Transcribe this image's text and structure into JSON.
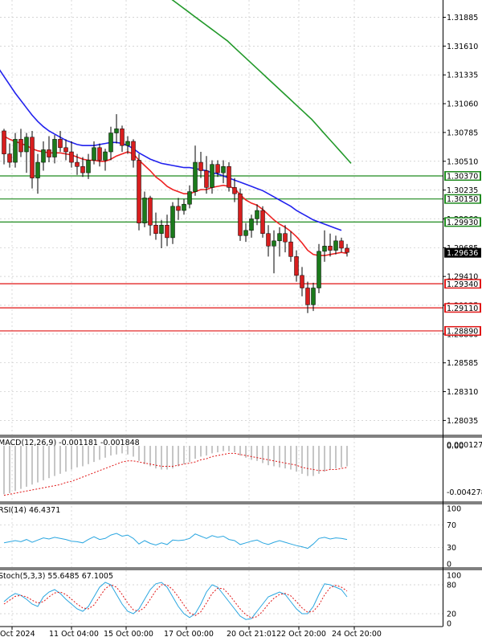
{
  "chart_data": {
    "type": "candlestick",
    "price_axis": {
      "range": [
        1.279,
        1.3205
      ],
      "ticks": [
        "1.31885",
        "1.31610",
        "1.31335",
        "1.31060",
        "1.30785",
        "1.30510",
        "1.30235",
        "1.29960",
        "1.29685",
        "1.29410",
        "1.29135",
        "1.28860",
        "1.28585",
        "1.28310",
        "1.28035"
      ]
    },
    "time_axis": {
      "labels": [
        "Oct 2024",
        "11 Oct 04:00",
        "15 Oct 00:00",
        "17 Oct 00:00",
        "20 Oct 21:01",
        "22 Oct 20:00",
        "24 Oct 20:00"
      ]
    },
    "current_price": "1.29636",
    "resistance_levels": [
      "1.30370",
      "1.30150",
      "1.29930"
    ],
    "support_levels": [
      "1.29340",
      "1.29110",
      "1.28890"
    ],
    "colors": {
      "bull": "#1b7a1b",
      "bear": "#d81e1e",
      "ma_fast": "#ee2222",
      "ma_mid": "#2222ee",
      "ma_slow": "#22992a",
      "resistance": "#1e8a1e",
      "support": "#e01515",
      "grid": "#c8c8c8",
      "signal": "#e01515",
      "stoch_main": "#2aa6e0"
    },
    "candles": [
      [
        1.308,
        1.3082,
        1.3048,
        1.3058
      ],
      [
        1.3058,
        1.3068,
        1.3045,
        1.305
      ],
      [
        1.305,
        1.3078,
        1.3045,
        1.3072
      ],
      [
        1.3072,
        1.3082,
        1.3055,
        1.306
      ],
      [
        1.306,
        1.3078,
        1.304,
        1.3074
      ],
      [
        1.3074,
        1.308,
        1.3025,
        1.3035
      ],
      [
        1.3035,
        1.3058,
        1.302,
        1.305
      ],
      [
        1.305,
        1.307,
        1.3042,
        1.3062
      ],
      [
        1.3062,
        1.3075,
        1.305,
        1.3055
      ],
      [
        1.3055,
        1.3076,
        1.3049,
        1.3072
      ],
      [
        1.3072,
        1.308,
        1.306,
        1.3064
      ],
      [
        1.3064,
        1.3072,
        1.3052,
        1.306
      ],
      [
        1.306,
        1.307,
        1.3045,
        1.305
      ],
      [
        1.305,
        1.3058,
        1.3038,
        1.3046
      ],
      [
        1.3046,
        1.3055,
        1.3036,
        1.304
      ],
      [
        1.304,
        1.3058,
        1.3034,
        1.3052
      ],
      [
        1.3052,
        1.307,
        1.3048,
        1.3064
      ],
      [
        1.3064,
        1.3068,
        1.3046,
        1.3052
      ],
      [
        1.3052,
        1.3063,
        1.3042,
        1.306
      ],
      [
        1.306,
        1.3084,
        1.3052,
        1.3078
      ],
      [
        1.3078,
        1.3096,
        1.3068,
        1.3082
      ],
      [
        1.3082,
        1.3085,
        1.306,
        1.3066
      ],
      [
        1.3066,
        1.3075,
        1.3058,
        1.307
      ],
      [
        1.307,
        1.3072,
        1.3045,
        1.3052
      ],
      [
        1.3052,
        1.3058,
        1.2985,
        1.2992
      ],
      [
        1.2992,
        1.3022,
        1.2988,
        1.3016
      ],
      [
        1.3016,
        1.3018,
        1.298,
        1.299
      ],
      [
        1.299,
        1.3002,
        1.2976,
        1.2982
      ],
      [
        1.2982,
        1.2995,
        1.2968,
        1.299
      ],
      [
        1.299,
        1.3,
        1.297,
        1.2978
      ],
      [
        1.2978,
        1.3012,
        1.2972,
        1.3008
      ],
      [
        1.3008,
        1.3016,
        1.2995,
        1.3004
      ],
      [
        1.3004,
        1.3015,
        1.3,
        1.301
      ],
      [
        1.301,
        1.3028,
        1.3006,
        1.3022
      ],
      [
        1.3022,
        1.3066,
        1.3018,
        1.305
      ],
      [
        1.305,
        1.306,
        1.3035,
        1.3042
      ],
      [
        1.3042,
        1.3056,
        1.302,
        1.3026
      ],
      [
        1.3026,
        1.3052,
        1.302,
        1.3048
      ],
      [
        1.3048,
        1.3052,
        1.3036,
        1.304
      ],
      [
        1.304,
        1.3052,
        1.303,
        1.3046
      ],
      [
        1.3046,
        1.305,
        1.3022,
        1.3026
      ],
      [
        1.3026,
        1.3035,
        1.3012,
        1.302
      ],
      [
        1.302,
        1.3025,
        1.2975,
        1.298
      ],
      [
        1.298,
        1.2992,
        1.2974,
        1.2985
      ],
      [
        1.2985,
        1.3,
        1.2978,
        1.2996
      ],
      [
        1.2996,
        1.301,
        1.299,
        1.3004
      ],
      [
        1.3004,
        1.3008,
        1.2978,
        1.2982
      ],
      [
        1.2982,
        1.299,
        1.296,
        1.297
      ],
      [
        1.297,
        1.2985,
        1.2944,
        1.2975
      ],
      [
        1.2975,
        1.2988,
        1.296,
        1.2982
      ],
      [
        1.2982,
        1.299,
        1.2964,
        1.2974
      ],
      [
        1.2974,
        1.2984,
        1.2955,
        1.296
      ],
      [
        1.296,
        1.2966,
        1.2936,
        1.2942
      ],
      [
        1.2942,
        1.295,
        1.2922,
        1.293
      ],
      [
        1.293,
        1.2936,
        1.2906,
        1.2914
      ],
      [
        1.2914,
        1.2935,
        1.2908,
        1.293
      ],
      [
        1.293,
        1.2972,
        1.2925,
        1.2965
      ],
      [
        1.2965,
        1.2985,
        1.2955,
        1.297
      ],
      [
        1.297,
        1.2982,
        1.296,
        1.2966
      ],
      [
        1.2966,
        1.298,
        1.2962,
        1.2975
      ],
      [
        1.2975,
        1.2978,
        1.2964,
        1.2968
      ],
      [
        1.2968,
        1.2972,
        1.296,
        1.2964
      ]
    ],
    "ma_fast": [
      1.3075,
      1.3072,
      1.307,
      1.3068,
      1.3066,
      1.3063,
      1.3061,
      1.306,
      1.3059,
      1.3059,
      1.3059,
      1.3058,
      1.3057,
      1.3055,
      1.3053,
      1.3052,
      1.3052,
      1.3051,
      1.3051,
      1.3053,
      1.3056,
      1.3058,
      1.306,
      1.3058,
      1.3052,
      1.3047,
      1.3042,
      1.3036,
      1.3032,
      1.3027,
      1.3024,
      1.3022,
      1.302,
      1.302,
      1.3022,
      1.3024,
      1.3024,
      1.3026,
      1.3027,
      1.3028,
      1.3027,
      1.3025,
      1.3019,
      1.3014,
      1.3011,
      1.3009,
      1.3005,
      1.3,
      1.2995,
      1.2991,
      1.2988,
      1.2984,
      1.2979,
      1.2973,
      1.2966,
      1.2962,
      1.2961,
      1.2961,
      1.2962,
      1.2963,
      1.2964,
      1.2963
    ],
    "ma_mid": [
      1.314,
      1.3132,
      1.3124,
      1.3116,
      1.3109,
      1.3102,
      1.3095,
      1.3089,
      1.3084,
      1.308,
      1.3077,
      1.3074,
      1.3071,
      1.3069,
      1.3067,
      1.3066,
      1.3066,
      1.3066,
      1.3067,
      1.3068,
      1.3069,
      1.3069,
      1.3068,
      1.3066,
      1.3063,
      1.3059,
      1.3056,
      1.3053,
      1.3051,
      1.3049,
      1.3048,
      1.3047,
      1.3046,
      1.3045,
      1.3045,
      1.3044,
      1.3043,
      1.3042,
      1.304,
      1.3039,
      1.3037,
      1.3035,
      1.3033,
      1.3031,
      1.3029,
      1.3027,
      1.3025,
      1.3023,
      1.302,
      1.3017,
      1.3014,
      1.3011,
      1.3008,
      1.3004,
      1.3001,
      1.2998,
      1.2995,
      1.2993,
      1.2991,
      1.2989,
      1.2987,
      1.2985
    ],
    "ma_slow": [
      1.325,
      1.3245,
      1.324,
      1.3235,
      1.323,
      1.3225,
      1.322,
      1.3215,
      1.321,
      1.3206,
      1.3202,
      1.3198,
      1.3194,
      1.319,
      1.3186,
      1.3182,
      1.3178,
      1.3174,
      1.317,
      1.3166,
      1.3161,
      1.3156,
      1.3151,
      1.3146,
      1.3141,
      1.3136,
      1.3131,
      1.3126,
      1.3121,
      1.3116,
      1.3111,
      1.3106,
      1.3101,
      1.3096,
      1.3091,
      1.3085,
      1.3079,
      1.3073,
      1.3067,
      1.3061,
      1.3055,
      1.3049
    ],
    "ma_slow_start_index": 20,
    "macd": {
      "label": "MACD(12,26,9) -0.001181 -0.001848",
      "ticks": [
        "0.000127",
        "0.00",
        "-0.004278"
      ],
      "range": [
        -0.005,
        0.0006
      ],
      "hist": [
        -0.0045,
        -0.0044,
        -0.0042,
        -0.004,
        -0.0038,
        -0.0036,
        -0.0034,
        -0.0032,
        -0.003,
        -0.0028,
        -0.0026,
        -0.0024,
        -0.0022,
        -0.002,
        -0.0019,
        -0.0017,
        -0.0015,
        -0.0013,
        -0.0011,
        -0.0009,
        -0.0008,
        -0.0007,
        -0.0008,
        -0.001,
        -0.0014,
        -0.0017,
        -0.0019,
        -0.0021,
        -0.0022,
        -0.0022,
        -0.0021,
        -0.0019,
        -0.0017,
        -0.0015,
        -0.0012,
        -0.001,
        -0.0009,
        -0.0007,
        -0.0006,
        -0.0005,
        -0.0005,
        -0.0006,
        -0.0009,
        -0.0011,
        -0.0013,
        -0.0014,
        -0.0016,
        -0.0018,
        -0.0019,
        -0.002,
        -0.0021,
        -0.0022,
        -0.0024,
        -0.0026,
        -0.0028,
        -0.0028,
        -0.0026,
        -0.0024,
        -0.0022,
        -0.0021,
        -0.002,
        -0.0019
      ],
      "signal": [
        -0.0046,
        -0.0045,
        -0.0044,
        -0.0043,
        -0.0042,
        -0.0041,
        -0.004,
        -0.0039,
        -0.0038,
        -0.0037,
        -0.0036,
        -0.0034,
        -0.0033,
        -0.0031,
        -0.0029,
        -0.0027,
        -0.0025,
        -0.0023,
        -0.0021,
        -0.0019,
        -0.0017,
        -0.0015,
        -0.0014,
        -0.0014,
        -0.0015,
        -0.0016,
        -0.0017,
        -0.0018,
        -0.0019,
        -0.0019,
        -0.0019,
        -0.0018,
        -0.0017,
        -0.0016,
        -0.0015,
        -0.0013,
        -0.0012,
        -0.001,
        -0.0009,
        -0.0008,
        -0.0007,
        -0.0007,
        -0.0008,
        -0.0009,
        -0.001,
        -0.0011,
        -0.0012,
        -0.0013,
        -0.0014,
        -0.0015,
        -0.0016,
        -0.0017,
        -0.0018,
        -0.002,
        -0.0021,
        -0.0022,
        -0.0023,
        -0.0023,
        -0.0022,
        -0.0022,
        -0.0021,
        -0.002
      ]
    },
    "rsi": {
      "label": "RSI(14) 46.4371",
      "ticks": [
        "100",
        "70",
        "30",
        "0"
      ],
      "range": [
        0,
        100
      ],
      "values": [
        38,
        40,
        42,
        40,
        44,
        39,
        43,
        47,
        45,
        48,
        46,
        44,
        41,
        40,
        38,
        44,
        49,
        44,
        46,
        52,
        55,
        50,
        52,
        46,
        36,
        42,
        37,
        34,
        38,
        35,
        43,
        42,
        43,
        46,
        54,
        50,
        46,
        51,
        48,
        50,
        44,
        42,
        35,
        38,
        41,
        43,
        38,
        35,
        39,
        42,
        39,
        36,
        33,
        31,
        28,
        36,
        46,
        48,
        45,
        47,
        46,
        44
      ]
    },
    "stoch": {
      "label": "Stoch(5,3,3) 55.6485 67.1005",
      "ticks": [
        "100",
        "80",
        "20",
        "0"
      ],
      "range": [
        0,
        100
      ],
      "main": [
        45,
        55,
        62,
        58,
        50,
        40,
        35,
        55,
        65,
        70,
        62,
        50,
        40,
        30,
        25,
        35,
        55,
        75,
        85,
        80,
        60,
        40,
        25,
        20,
        30,
        50,
        70,
        82,
        85,
        75,
        55,
        35,
        20,
        12,
        20,
        40,
        65,
        80,
        75,
        60,
        45,
        30,
        15,
        8,
        10,
        25,
        40,
        55,
        60,
        65,
        60,
        45,
        30,
        20,
        20,
        35,
        60,
        82,
        80,
        75,
        70,
        55
      ],
      "signal": [
        40,
        48,
        56,
        58,
        55,
        48,
        42,
        45,
        55,
        63,
        65,
        60,
        50,
        40,
        32,
        30,
        38,
        55,
        72,
        80,
        75,
        60,
        42,
        28,
        25,
        33,
        50,
        68,
        80,
        80,
        70,
        55,
        38,
        22,
        16,
        24,
        42,
        62,
        73,
        72,
        60,
        45,
        30,
        18,
        11,
        14,
        25,
        40,
        52,
        60,
        62,
        57,
        45,
        32,
        23,
        25,
        38,
        59,
        74,
        79,
        75,
        67
      ]
    }
  }
}
